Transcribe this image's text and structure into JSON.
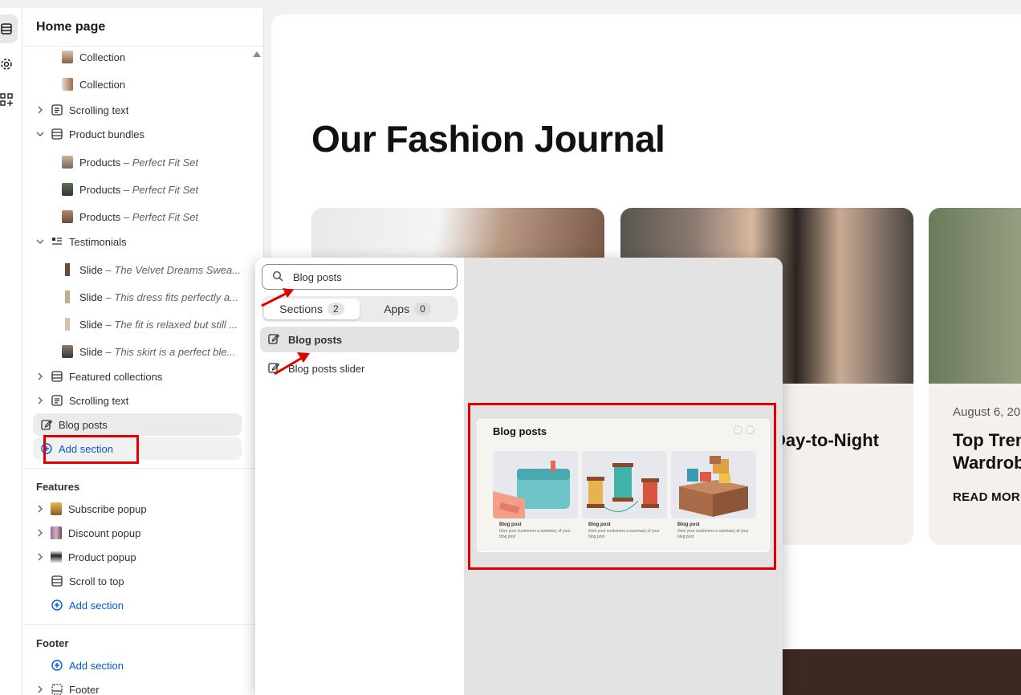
{
  "rail": {
    "items": [
      {
        "name": "sections-icon",
        "active": true
      },
      {
        "name": "settings-icon",
        "active": false
      },
      {
        "name": "apps-icon",
        "active": false
      }
    ]
  },
  "sidebar": {
    "title": "Home page",
    "items": [
      {
        "label": "Collection",
        "sub": ""
      },
      {
        "label": "Collection",
        "sub": ""
      },
      {
        "label": "Scrolling text",
        "sub": ""
      },
      {
        "label": "Product bundles",
        "sub": ""
      },
      {
        "label": "Products",
        "sub": " – Perfect Fit Set"
      },
      {
        "label": "Products",
        "sub": " – Perfect Fit Set"
      },
      {
        "label": "Products",
        "sub": " – Perfect Fit Set"
      },
      {
        "label": "Testimonials",
        "sub": ""
      },
      {
        "label": "Slide",
        "sub": " – The Velvet Dreams Swea..."
      },
      {
        "label": "Slide",
        "sub": " – This dress fits perfectly a..."
      },
      {
        "label": "Slide",
        "sub": " – The fit is relaxed but still ..."
      },
      {
        "label": "Slide",
        "sub": " – This skirt is a perfect ble..."
      },
      {
        "label": "Featured collections",
        "sub": ""
      },
      {
        "label": "Scrolling text",
        "sub": ""
      },
      {
        "label": "Blog posts",
        "sub": ""
      },
      {
        "label": "Add section",
        "sub": ""
      }
    ],
    "features": {
      "title": "Features",
      "items": [
        "Subscribe popup",
        "Discount popup",
        "Product popup",
        "Scroll to top",
        "Add section"
      ]
    },
    "footer": {
      "title": "Footer",
      "items": [
        "Add section",
        "Footer"
      ]
    }
  },
  "preview": {
    "heading": "Our Fashion Journal",
    "cards": [
      {
        "date": "",
        "title": "",
        "read": ""
      },
      {
        "date": "",
        "title": "Day-to-Night",
        "read": ""
      },
      {
        "date": "August 6, 20",
        "title": "Top Tren\nWardrob",
        "read": "READ MOR"
      }
    ]
  },
  "popover": {
    "search_value": "Blog posts",
    "tabs": [
      {
        "label": "Sections",
        "count": "2"
      },
      {
        "label": "Apps",
        "count": "0"
      }
    ],
    "results": [
      "Blog posts",
      "Blog posts slider"
    ],
    "preview_card": {
      "title": "Blog posts",
      "items": [
        {
          "caption": "Blog post",
          "text": "Give your customers a summary of your blog post"
        },
        {
          "caption": "Blog post",
          "text": "Give your customers a summary of your blog post"
        },
        {
          "caption": "Blog post",
          "text": "Give your customers a summary of your blog post"
        }
      ]
    }
  },
  "colors": {
    "accent_link": "#005bd3",
    "annotation_red": "#e00000"
  }
}
